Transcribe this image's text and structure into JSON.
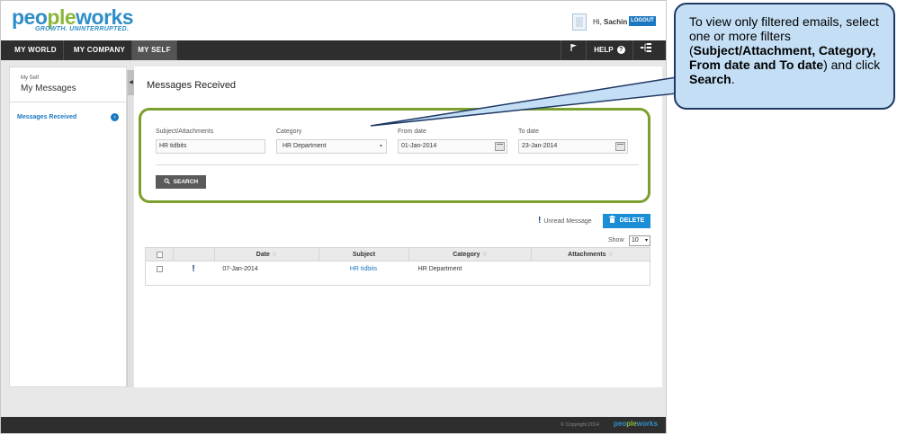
{
  "header": {
    "logo_first": "peo",
    "logo_mid": "ple",
    "logo_last": "works",
    "tagline": "GROWTH. UNINTERRUPTED.",
    "greeting_prefix": "Hi,",
    "user_name": "Sachin",
    "logout_label": "LOGOUT"
  },
  "nav": {
    "tabs": [
      {
        "label": "MY WORLD"
      },
      {
        "label": "MY COMPANY"
      },
      {
        "label": "MY SELF"
      }
    ],
    "active_tab": "MY SELF",
    "help_label": "HELP",
    "help_glyph": "?"
  },
  "sidebar": {
    "breadcrumb": "My Self",
    "title": "My Messages",
    "items": [
      {
        "label": "Messages Received"
      }
    ]
  },
  "main": {
    "title": "Messages Received",
    "filters": {
      "subject_label": "Subject/Attachments",
      "subject_value": "HR tidbits",
      "category_label": "Category",
      "category_value": "HR Department",
      "from_label": "From date",
      "from_value": "01-Jan-2014",
      "to_label": "To date",
      "to_value": "23-Jan-2014",
      "search_label": "SEARCH"
    },
    "legend_label": "Unread Message",
    "delete_label": "DELETE",
    "show_label": "Show",
    "show_value": "10",
    "table": {
      "columns": [
        "Date",
        "Subject",
        "Category",
        "Attachments"
      ],
      "sort_glyph": "♢",
      "rows": [
        {
          "date": "07-Jan-2014",
          "subject": "HR tidbits",
          "category": "HR Department",
          "attachments": ""
        }
      ]
    }
  },
  "footer": {
    "copyright": "© Copyright 2014"
  },
  "callout": {
    "line1": "To view only filtered emails, select one or more filters (",
    "bold1": "Subject/Attachment, Category, From date and To date",
    "line2": ") and click ",
    "bold2": "Search",
    "line3": "."
  },
  "colors": {
    "brand_blue": "#2f8ec8",
    "brand_green": "#8ab63a",
    "nav_bg": "#2e2e2e",
    "filter_border": "#7aa02f",
    "callout_fill": "#c4dff5",
    "callout_border": "#1f3864",
    "delete_button": "#1a8fd6"
  },
  "icons": [
    "search-icon",
    "trash-icon",
    "flag-icon",
    "help-icon",
    "sitemap-icon",
    "calendar-icon",
    "arrow-right-circle-icon",
    "collapse-arrow-icon",
    "unread-exclamation-icon"
  ]
}
